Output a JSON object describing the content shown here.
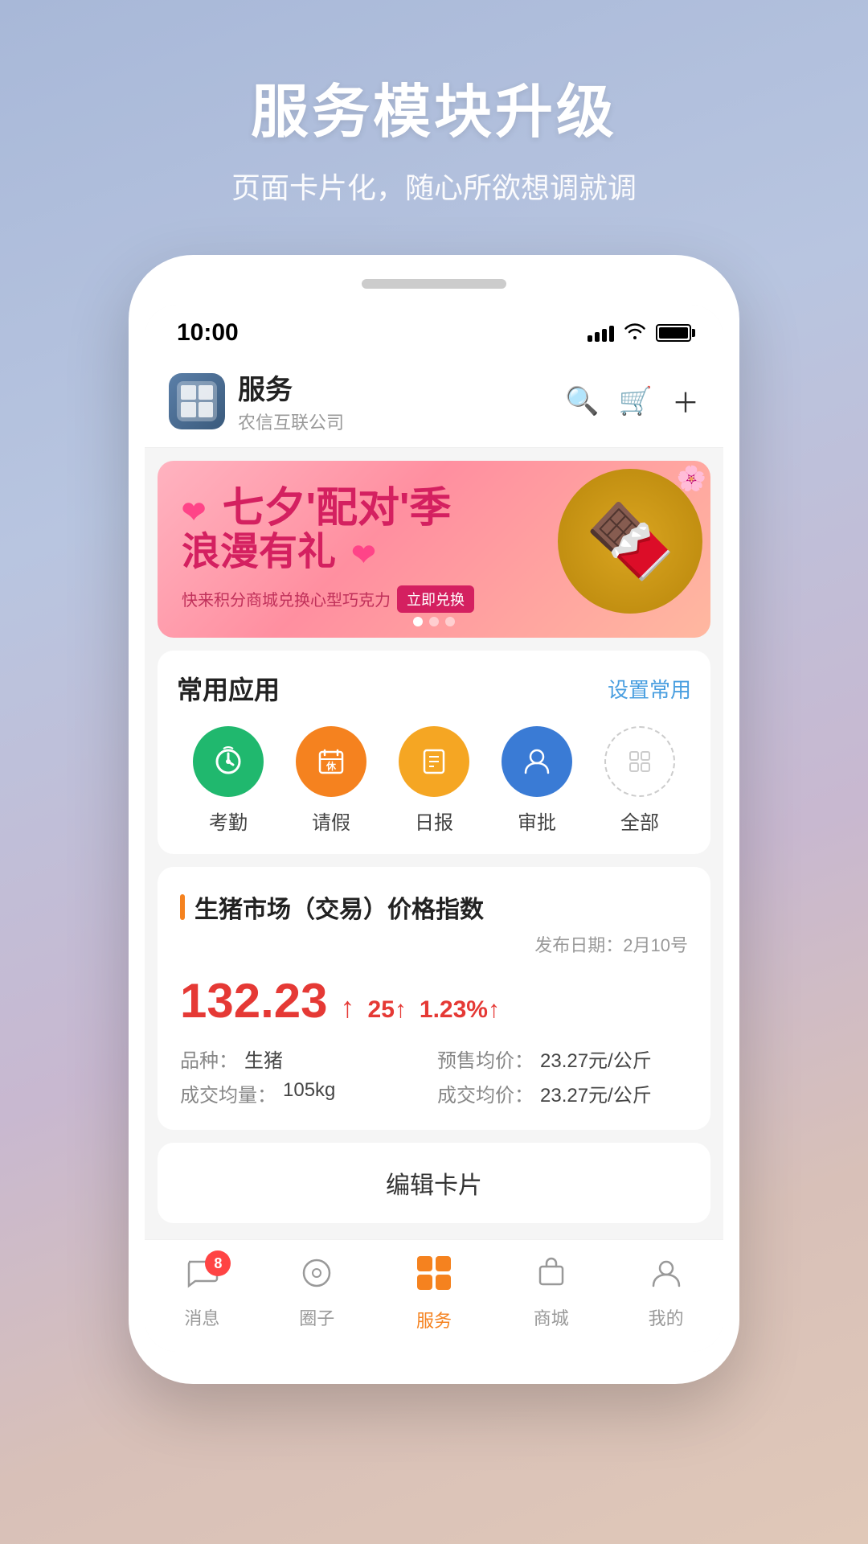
{
  "page": {
    "background": "linear-gradient(160deg, #a8b8d8, #b8c5e0, #c8b8d0, #d8c0b8, #e0c8b8)"
  },
  "header": {
    "title": "服务模块升级",
    "subtitle": "页面卡片化，随心所欲想调就调"
  },
  "statusBar": {
    "time": "10:00",
    "timeArrow": "▶"
  },
  "appHeader": {
    "appName": "服务",
    "company": "农信互联公司",
    "searchLabel": "搜索",
    "cartLabel": "购物车",
    "addLabel": "添加"
  },
  "banner": {
    "title": "七夕'配对'季",
    "subtitle": "浪漫有礼",
    "heartLeft": "❤",
    "heartRight": "❤",
    "cta": "快来积分商城兑换心型巧克力",
    "ctaAction": "立即兑换",
    "dots": [
      {
        "active": true
      },
      {
        "active": false
      },
      {
        "active": false
      }
    ]
  },
  "commonApps": {
    "sectionTitle": "常用应用",
    "actionLabel": "设置常用",
    "apps": [
      {
        "name": "考勤",
        "icon": "✱",
        "color": "green"
      },
      {
        "name": "请假",
        "icon": "📅",
        "color": "orange"
      },
      {
        "name": "日报",
        "icon": "📋",
        "color": "yellow"
      },
      {
        "name": "审批",
        "icon": "👤",
        "color": "blue"
      },
      {
        "name": "全部",
        "icon": "⊞",
        "color": "outline"
      }
    ]
  },
  "marketCard": {
    "indicator": true,
    "title": "生猪市场（交易）价格指数",
    "publishDate": "发布日期：2月10号",
    "priceMain": "132.23",
    "priceArrow": "↑",
    "change1": "25↑",
    "change2": "1.23%↑",
    "details": [
      {
        "label": "品种：",
        "value": "生猪"
      },
      {
        "label": "预售均价：",
        "value": "23.27元/公斤"
      },
      {
        "label": "成交均量：",
        "value": "105kg"
      },
      {
        "label": "成交均价：",
        "value": "23.27元/公斤"
      }
    ]
  },
  "editCardBtn": {
    "label": "编辑卡片"
  },
  "bottomNav": {
    "items": [
      {
        "label": "消息",
        "icon": "💬",
        "badge": "8",
        "active": false
      },
      {
        "label": "圈子",
        "icon": "⊙",
        "badge": "",
        "active": false
      },
      {
        "label": "服务",
        "icon": "⊞",
        "badge": "",
        "active": true
      },
      {
        "label": "商城",
        "icon": "🛍",
        "badge": "",
        "active": false
      },
      {
        "label": "我的",
        "icon": "👤",
        "badge": "",
        "active": false
      }
    ]
  }
}
